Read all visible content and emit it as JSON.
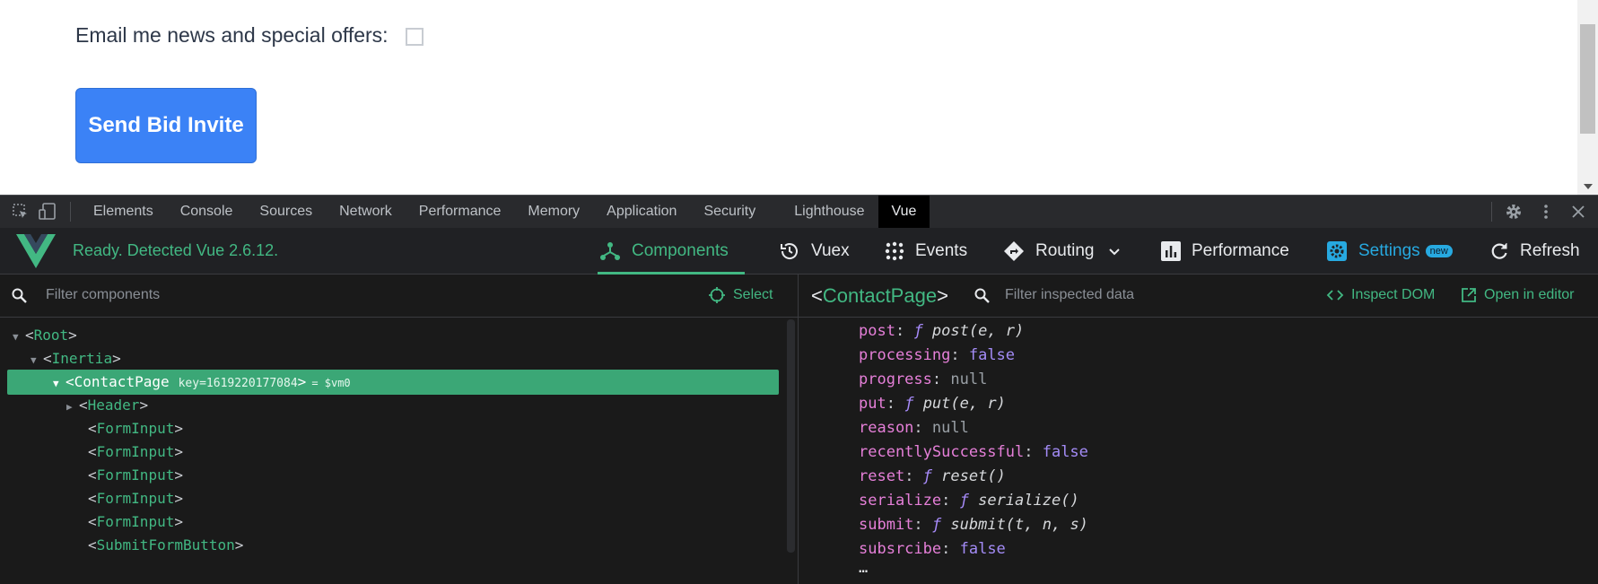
{
  "form": {
    "email_label": "Email me news and special offers:",
    "email_checked": false,
    "submit_label": "Send Bid Invite"
  },
  "devtools": {
    "tabs": [
      "Elements",
      "Console",
      "Sources",
      "Network",
      "Performance",
      "Memory",
      "Application",
      "Security",
      "Lighthouse",
      "Vue"
    ],
    "active_tab": "Vue"
  },
  "vue": {
    "status": "Ready. Detected Vue 2.6.12.",
    "nav": {
      "components": "Components",
      "vuex": "Vuex",
      "events": "Events",
      "routing": "Routing",
      "performance": "Performance",
      "settings": "Settings",
      "settings_badge": "new",
      "refresh": "Refresh"
    },
    "filter_components_placeholder": "Filter components",
    "select_label": "Select",
    "tree": [
      {
        "name": "Root",
        "indent": 0,
        "expander": "open"
      },
      {
        "name": "Inertia",
        "indent": 1,
        "expander": "open"
      },
      {
        "name": "ContactPage",
        "indent": 2,
        "expander": "open",
        "key": "key=1619220177084",
        "vm": "= $vm0",
        "selected": true
      },
      {
        "name": "Header",
        "indent": 3,
        "expander": "closed"
      },
      {
        "name": "FormInput",
        "indent": 3,
        "expander": "none"
      },
      {
        "name": "FormInput",
        "indent": 3,
        "expander": "none"
      },
      {
        "name": "FormInput",
        "indent": 3,
        "expander": "none"
      },
      {
        "name": "FormInput",
        "indent": 3,
        "expander": "none"
      },
      {
        "name": "FormInput",
        "indent": 3,
        "expander": "none"
      },
      {
        "name": "SubmitFormButton",
        "indent": 3,
        "expander": "none"
      }
    ],
    "inspector": {
      "component_name": "ContactPage",
      "filter_placeholder": "Filter inspected data",
      "inspect_dom": "Inspect DOM",
      "open_in_editor": "Open in editor",
      "props": [
        {
          "key": "post",
          "type": "function",
          "value": "post(e, r)"
        },
        {
          "key": "processing",
          "type": "bool",
          "value": "false"
        },
        {
          "key": "progress",
          "type": "null",
          "value": "null"
        },
        {
          "key": "put",
          "type": "function",
          "value": "put(e, r)"
        },
        {
          "key": "reason",
          "type": "null",
          "value": "null"
        },
        {
          "key": "recentlySuccessful",
          "type": "bool",
          "value": "false"
        },
        {
          "key": "reset",
          "type": "function",
          "value": "reset()"
        },
        {
          "key": "serialize",
          "type": "function",
          "value": "serialize()"
        },
        {
          "key": "submit",
          "type": "function",
          "value": "submit(t, n, s)"
        },
        {
          "key": "subsrcibe",
          "type": "bool",
          "value": "false"
        }
      ],
      "more": "…"
    }
  }
}
